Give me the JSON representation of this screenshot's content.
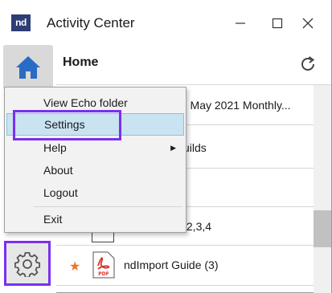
{
  "app": {
    "logo_text": "nd",
    "title": "Activity Center",
    "buttons": {
      "minimize": "minimize",
      "maximize": "maximize",
      "close": "close"
    }
  },
  "rail": {
    "home_icon": "home-icon",
    "settings_icon": "gear-icon"
  },
  "header": {
    "title": "Home",
    "refresh_icon": "refresh-icon"
  },
  "list": {
    "items": [
      {
        "text": "- May 2021 Monthly..."
      },
      {
        "text": "uilds"
      },
      {
        "text": ",2,3,4"
      },
      {
        "text": "ndImport Guide (3)",
        "starred": true,
        "icon": "pdf-icon",
        "icon_label": "PDF"
      }
    ]
  },
  "menu": {
    "items": [
      {
        "label": "View Echo folder"
      },
      {
        "label": "Settings",
        "selected": true
      },
      {
        "label": "Help",
        "has_submenu": true
      },
      {
        "label": "About"
      },
      {
        "label": "Logout"
      },
      {
        "label": "Exit"
      }
    ]
  },
  "colors": {
    "highlight": "#7b2ff0",
    "selected_bg": "#c9e3f1",
    "home_icon": "#2a6cc4",
    "star": "#e8782a",
    "pdf": "#d9312a"
  }
}
